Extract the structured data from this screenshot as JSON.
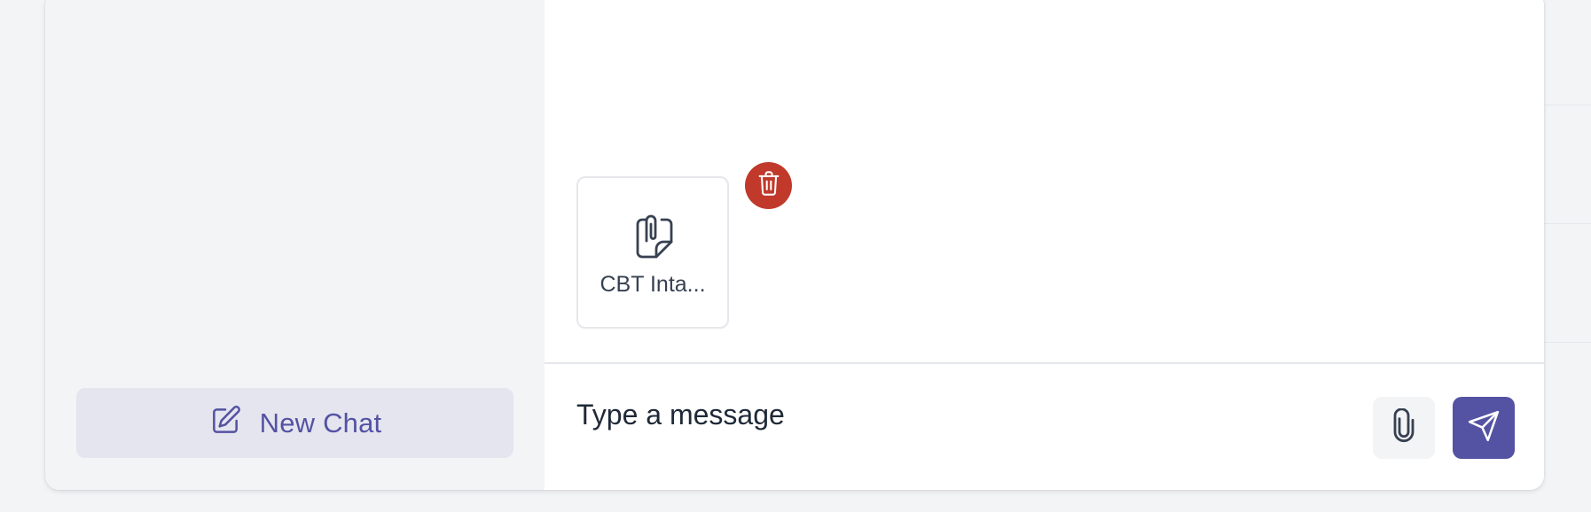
{
  "sidebar": {
    "new_chat_label": "New Chat",
    "new_chat_icon": "edit-square-icon"
  },
  "attachment": {
    "name": "CBT Inta...",
    "icon": "file-attachment-icon",
    "remove_icon": "trash-icon"
  },
  "composer": {
    "placeholder": "Type a message",
    "value": "",
    "attach_icon": "paperclip-icon",
    "send_icon": "send-icon"
  },
  "colors": {
    "accent": "#5452a3",
    "new_chat_bg": "#e5e5ef",
    "delete": "#c0392b",
    "sidebar_bg": "#f3f4f6"
  }
}
